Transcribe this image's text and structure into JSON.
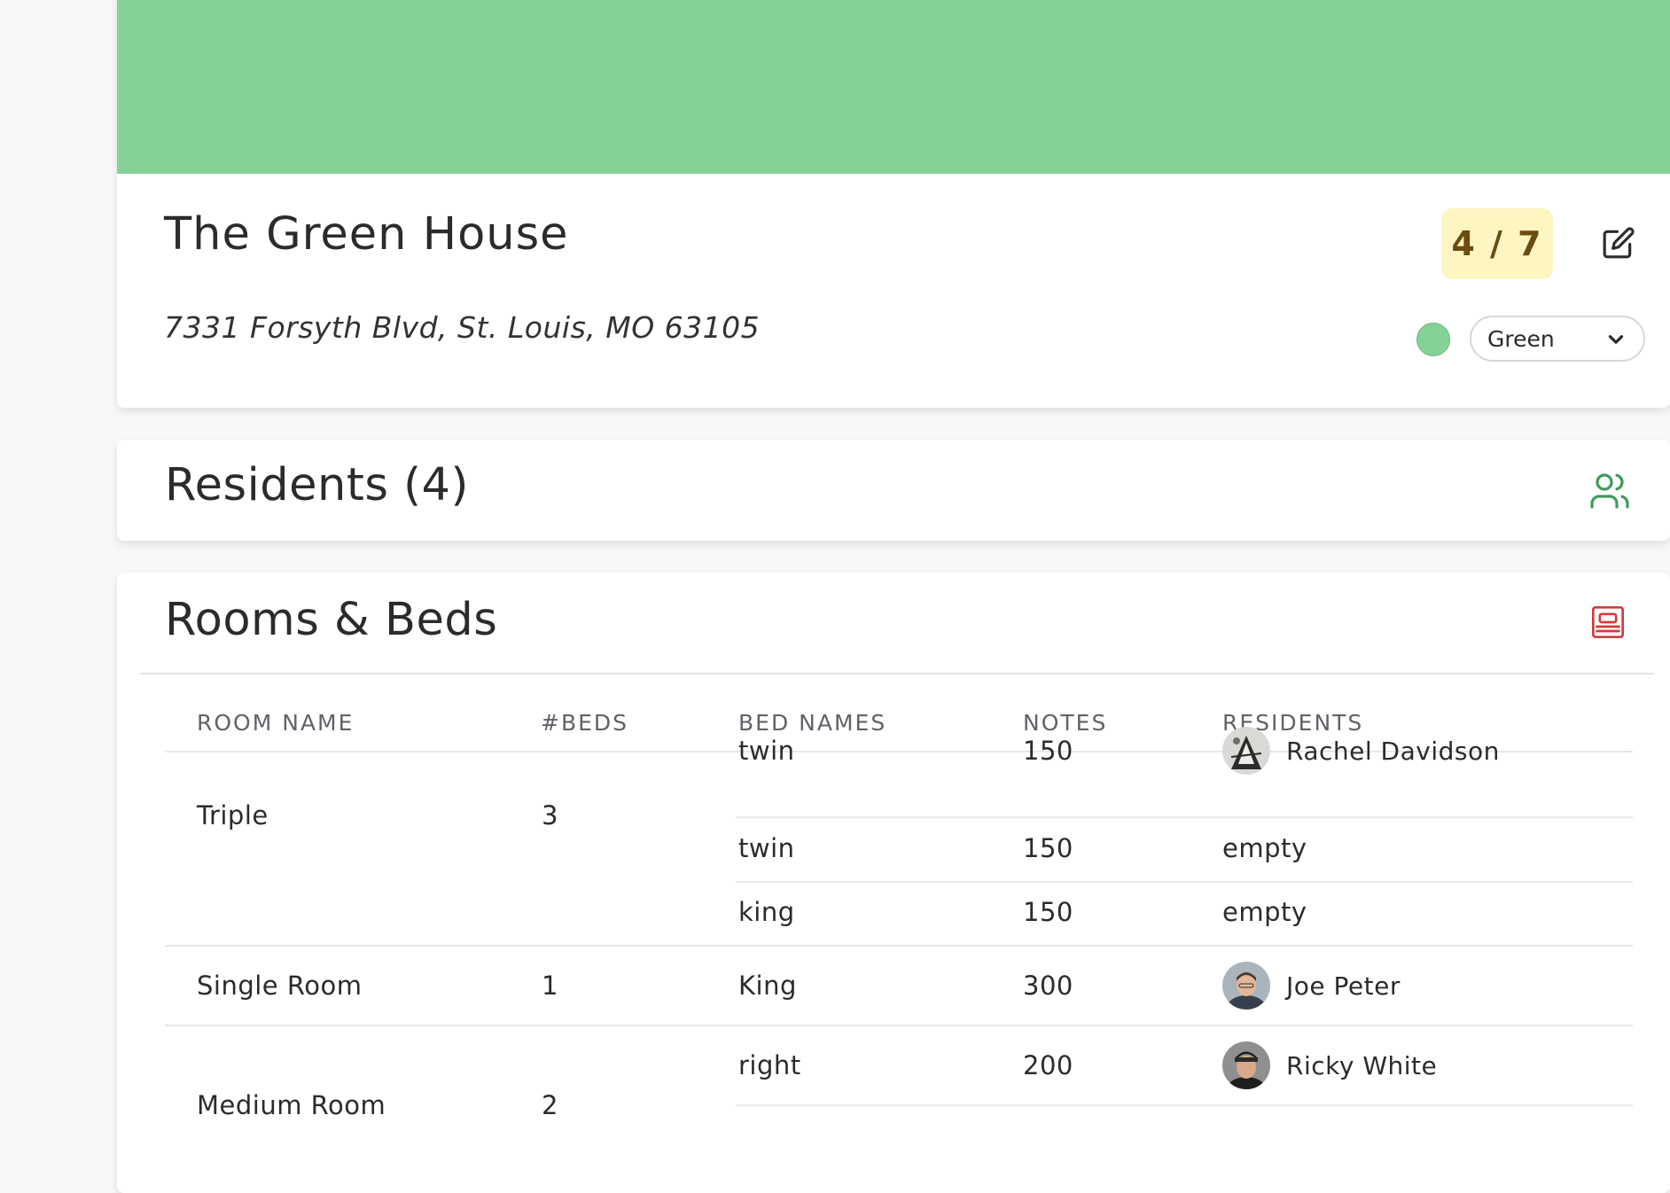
{
  "house": {
    "name": "The Green House",
    "address": "7331 Forsyth Blvd, St. Louis, MO 63105",
    "occupancy": "4 / 7",
    "occupancy_fraction": 0.571,
    "color_label": "Green",
    "color_hex": "#85d296"
  },
  "residents_section": {
    "title": "Residents (4)",
    "icon": "users-icon"
  },
  "rooms_section": {
    "title": "Rooms & Beds",
    "icon": "bed-icon",
    "columns": [
      "ROOM NAME",
      "#BEDS",
      "BED NAMES",
      "NOTES",
      "RESIDENTS"
    ],
    "rooms": [
      {
        "name": "Triple",
        "beds_count": "3",
        "beds": [
          {
            "name": "twin",
            "notes": "150",
            "resident": "Rachel Davidson",
            "has_avatar": true
          },
          {
            "name": "twin",
            "notes": "150",
            "resident": "empty",
            "has_avatar": false
          },
          {
            "name": "king",
            "notes": "150",
            "resident": "empty",
            "has_avatar": false
          }
        ]
      },
      {
        "name": "Single Room",
        "beds_count": "1",
        "beds": [
          {
            "name": "King",
            "notes": "300",
            "resident": "Joe Peter",
            "has_avatar": true
          }
        ]
      },
      {
        "name": "Medium Room",
        "beds_count": "2",
        "beds": [
          {
            "name": "right",
            "notes": "200",
            "resident": "Ricky White",
            "has_avatar": true
          }
        ]
      }
    ]
  },
  "colors": {
    "banner": "#85d296",
    "badge_bg": "#fdf6c2",
    "badge_text": "#6b4c12",
    "residents_icon": "#3f9a5c",
    "beds_icon": "#d23b3b"
  }
}
